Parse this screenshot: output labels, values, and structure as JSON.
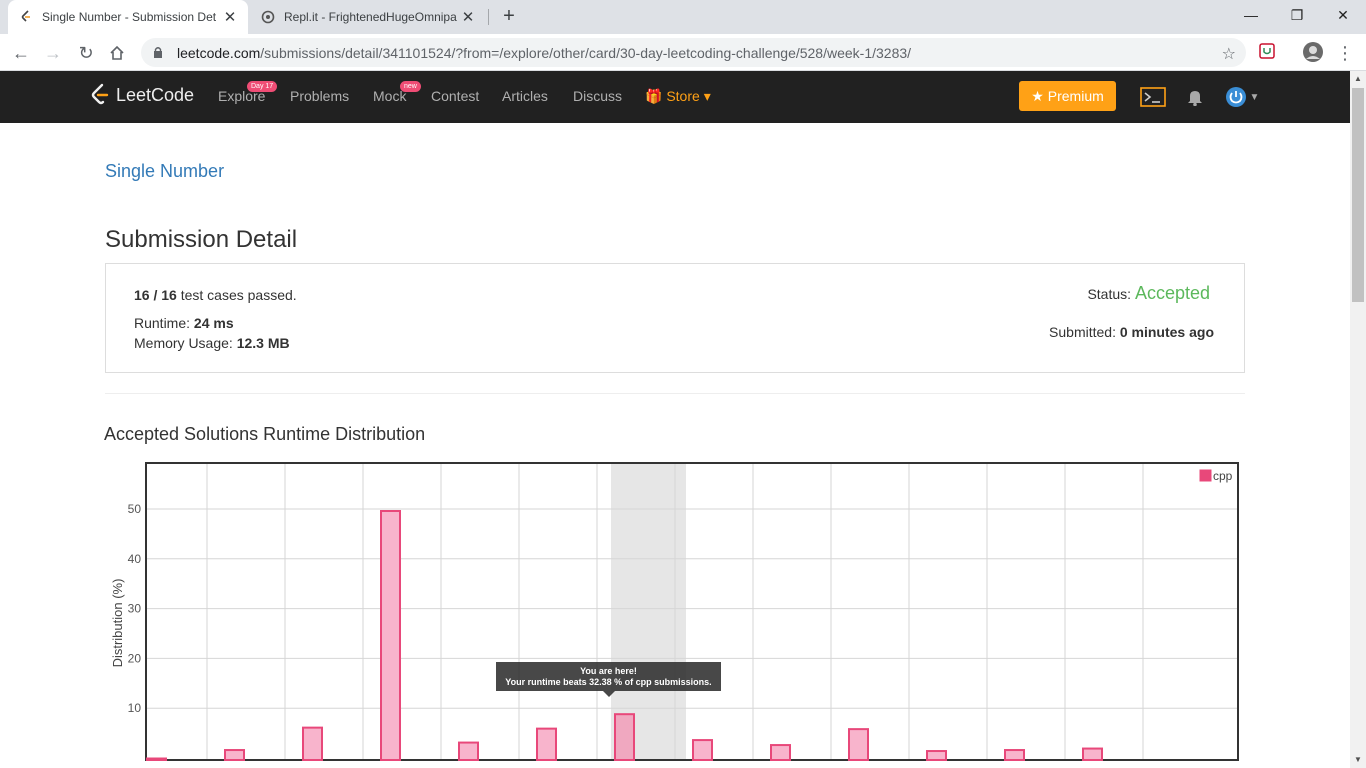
{
  "browser": {
    "tabs": [
      {
        "title": "Single Number - Submission Det",
        "active": true
      },
      {
        "title": "Repl.it - FrightenedHugeOmnipa",
        "active": false
      }
    ],
    "url_host": "leetcode.com",
    "url_path": "/submissions/detail/341101524/?from=/explore/other/card/30-day-leetcoding-challenge/528/week-1/3283/"
  },
  "nav": {
    "logo": "LeetCode",
    "explore": "Explore",
    "explore_badge": "Day 17",
    "problems": "Problems",
    "mock": "Mock",
    "mock_badge": "new",
    "contest": "Contest",
    "articles": "Articles",
    "discuss": "Discuss",
    "store": "Store",
    "premium": "Premium"
  },
  "page": {
    "problem_title": "Single Number",
    "section_title": "Submission Detail",
    "passed": "16",
    "total": "16",
    "passed_suffix": "test cases passed.",
    "runtime_label": "Runtime:",
    "runtime_value": "24 ms",
    "memory_label": "Memory Usage:",
    "memory_value": "12.3 MB",
    "status_label": "Status:",
    "status_value": "Accepted",
    "submitted_label": "Submitted:",
    "submitted_value": "0 minutes ago",
    "distribution_title": "Accepted Solutions Runtime Distribution"
  },
  "colors": {
    "accent": "#ffa116",
    "accepted": "#5cb85c",
    "bar_fill": "#f8b4cc",
    "bar_stroke": "#e8487a",
    "link": "#337ab7"
  },
  "chart_data": {
    "type": "bar",
    "ylabel": "Distribution (%)",
    "yticks": [
      10,
      20,
      30,
      40,
      50
    ],
    "legend": "cpp",
    "values": [
      0.3,
      2,
      6.5,
      50,
      3.5,
      6.3,
      9.2,
      4,
      3,
      6.2,
      1.8,
      2,
      2.3,
      0
    ],
    "highlight_index": 6,
    "tooltip_line1": "You are here!",
    "tooltip_line2": "Your runtime beats 32.38 % of cpp submissions."
  }
}
